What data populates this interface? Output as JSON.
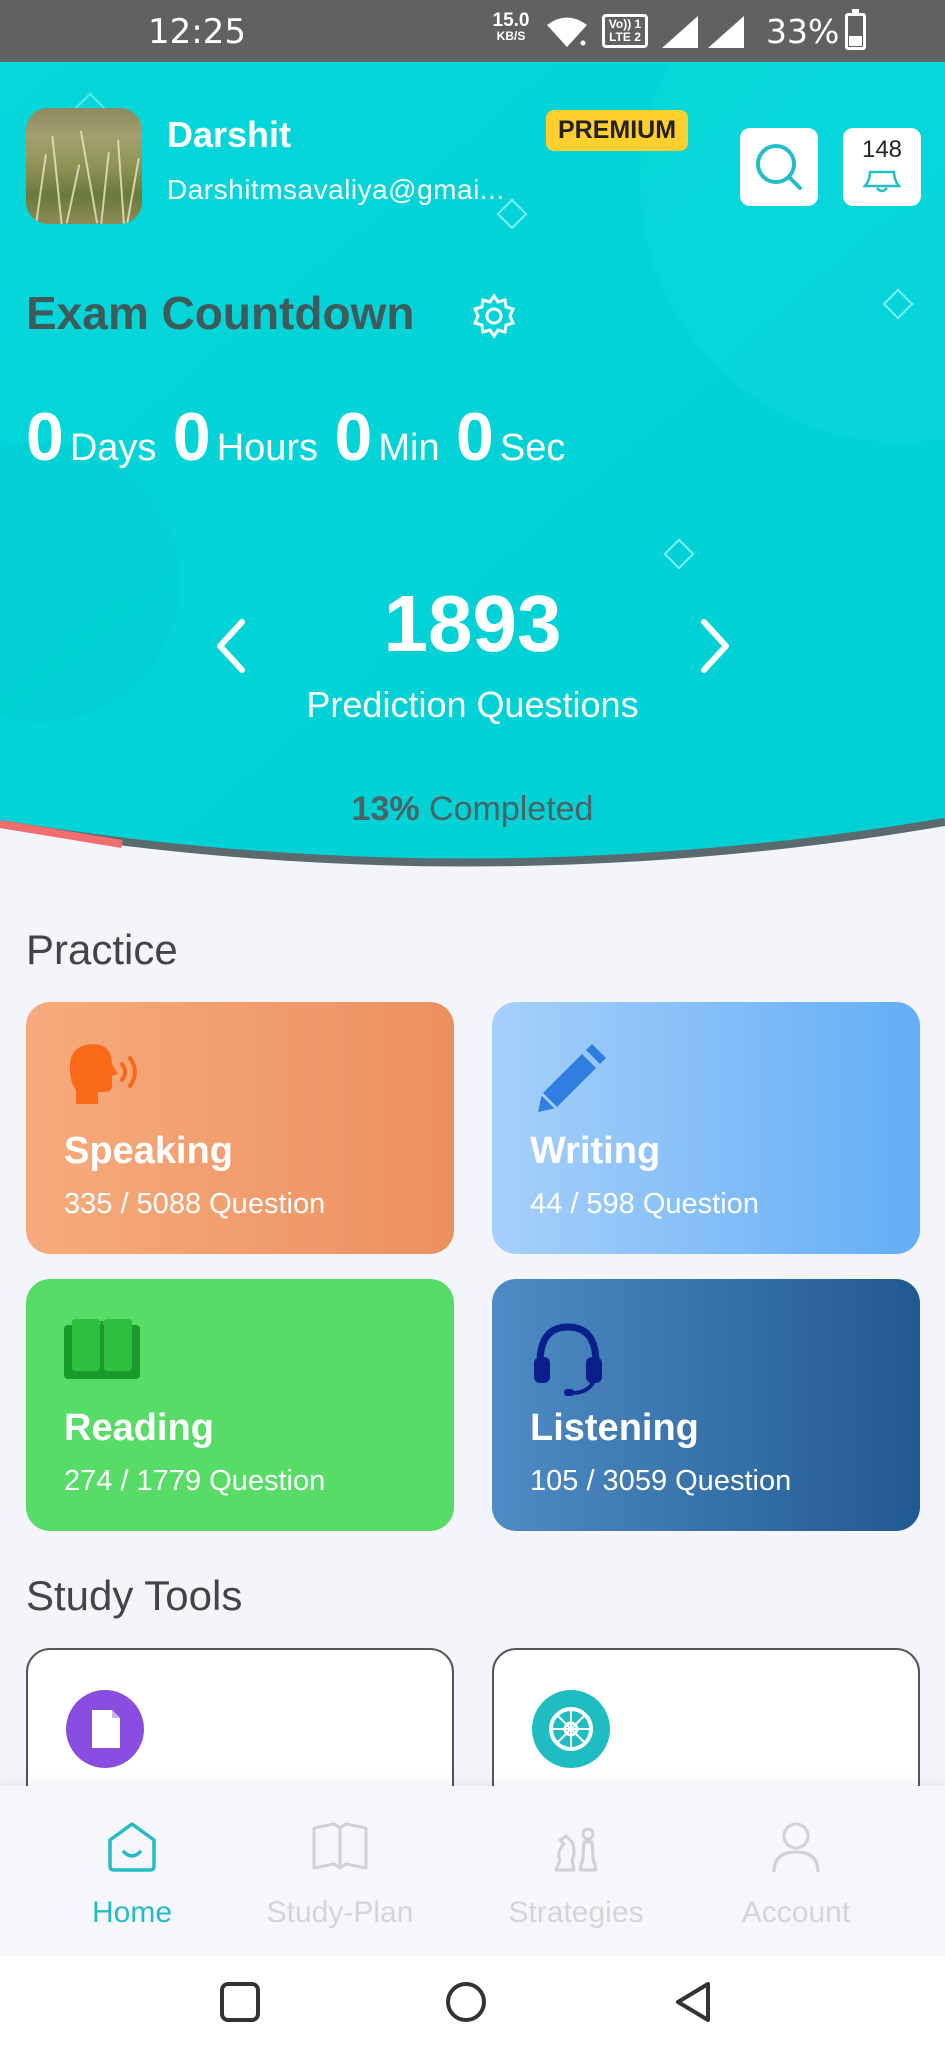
{
  "status_bar": {
    "time": "12:25",
    "net_speed": "15.0",
    "net_speed_unit": "KB/S",
    "volte_line1": "Vo)) 1",
    "volte_line2": "LTE 2",
    "battery": "33%"
  },
  "profile": {
    "name": "Darshit",
    "email": "Darshitmsavaliya@gmai...",
    "badge": "PREMIUM",
    "notification_count": "148"
  },
  "exam": {
    "title": "Exam Countdown",
    "days": "0",
    "days_label": "Days",
    "hours": "0",
    "hours_label": "Hours",
    "min": "0",
    "min_label": "Min",
    "sec": "0",
    "sec_label": "Sec"
  },
  "prediction": {
    "count": "1893",
    "label": "Prediction Questions",
    "percent": "13%",
    "completed_label": "Completed"
  },
  "practice": {
    "title": "Practice",
    "cards": [
      {
        "title": "Speaking",
        "progress": "335 / 5088 Question"
      },
      {
        "title": "Writing",
        "progress": "44 / 598 Question"
      },
      {
        "title": "Reading",
        "progress": "274 / 1779 Question"
      },
      {
        "title": "Listening",
        "progress": "105 / 3059 Question"
      }
    ]
  },
  "study_tools": {
    "title": "Study Tools"
  },
  "nav": {
    "items": [
      {
        "label": "Home"
      },
      {
        "label": "Study-Plan"
      },
      {
        "label": "Strategies"
      },
      {
        "label": "Account"
      }
    ]
  },
  "colors": {
    "accent": "#23bdc7",
    "header_bg": "#00d5d8",
    "premium": "#ffcf2d",
    "speaking": "#f29a6c",
    "writing": "#7bbcf7",
    "reading": "#58dc68",
    "listening": "#2e6ca5"
  }
}
